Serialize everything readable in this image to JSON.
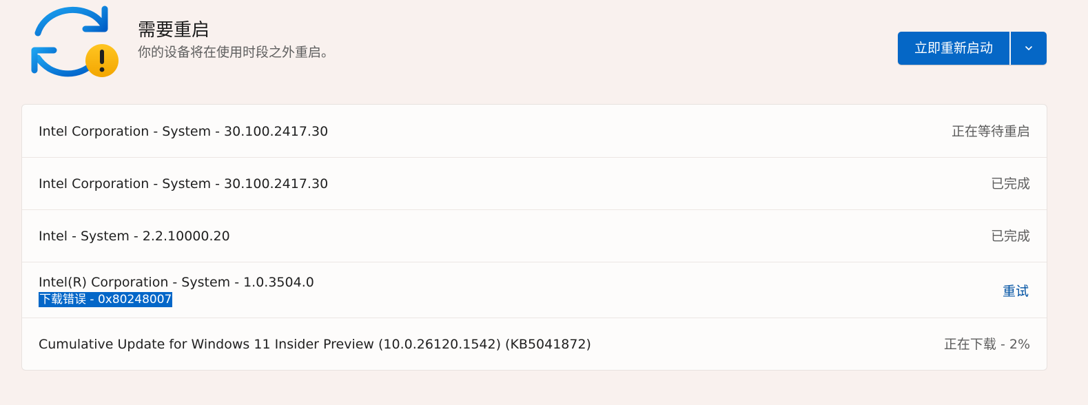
{
  "header": {
    "title": "需要重启",
    "subtitle": "你的设备将在使用时段之外重启。",
    "icon": "sync-warning-icon",
    "primary_button_label": "立即重新启动",
    "dropdown_icon": "chevron-down-icon"
  },
  "updates": [
    {
      "title": "Intel Corporation - System - 30.100.2417.30",
      "status": "正在等待重启"
    },
    {
      "title": "Intel Corporation - System - 30.100.2417.30",
      "status": "已完成"
    },
    {
      "title": "Intel - System - 2.2.10000.20",
      "status": "已完成"
    },
    {
      "title": "Intel(R) Corporation - System - 1.0.3504.0",
      "error": "下载错误 - 0x80248007",
      "action": "重试"
    },
    {
      "title": "Cumulative Update for Windows 11 Insider Preview (10.0.26120.1542) (KB5041872)",
      "status": "正在下载 - 2%"
    }
  ],
  "colors": {
    "background": "#f9f1ee",
    "accent": "#0567c6",
    "warning": "#f7b500",
    "link": "#0052a3"
  }
}
